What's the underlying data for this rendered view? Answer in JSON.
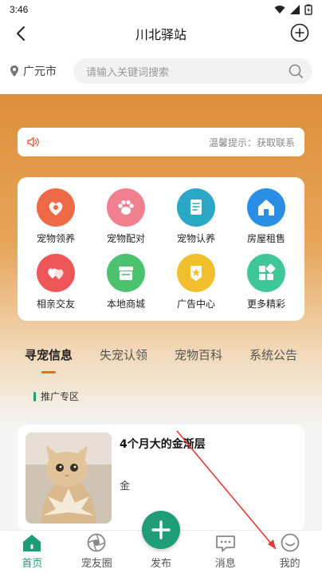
{
  "status_bar": {
    "time": "3:46"
  },
  "header": {
    "title": "川北驿站"
  },
  "search": {
    "location": "广元市",
    "placeholder": "请输入关键词搜索"
  },
  "notice": {
    "text": "温馨提示：获取联系"
  },
  "services": [
    {
      "label": "宠物领养",
      "icon": "pet-adopt-icon",
      "color": "#ee6a47"
    },
    {
      "label": "宠物配对",
      "icon": "paw-icon",
      "color": "#f0808f"
    },
    {
      "label": "宠物认养",
      "icon": "document-icon",
      "color": "#2aa8c5"
    },
    {
      "label": "房屋租售",
      "icon": "house-icon",
      "color": "#2a8fe4"
    },
    {
      "label": "相亲交友",
      "icon": "hearts-icon",
      "color": "#ec5658"
    },
    {
      "label": "本地商城",
      "icon": "shop-icon",
      "color": "#4cc26e"
    },
    {
      "label": "广告中心",
      "icon": "star-badge-icon",
      "color": "#f1bf2d"
    },
    {
      "label": "更多精彩",
      "icon": "grid-icon",
      "color": "#3fc79a"
    }
  ],
  "tabs": [
    {
      "label": "寻宠信息",
      "active": true
    },
    {
      "label": "失宠认领",
      "active": false
    },
    {
      "label": "宠物百科",
      "active": false
    },
    {
      "label": "系统公告",
      "active": false
    }
  ],
  "promo": {
    "label": "推广专区"
  },
  "listing": {
    "title": "4个月大的金渐层",
    "subtitle": "金"
  },
  "bottom_nav": [
    {
      "label": "首页",
      "icon": "home-icon",
      "active": true
    },
    {
      "label": "宠友圈",
      "icon": "camera-shutter-icon",
      "active": false
    },
    {
      "label": "发布",
      "icon": "plus-icon",
      "active": false
    },
    {
      "label": "消息",
      "icon": "message-icon",
      "active": false
    },
    {
      "label": "我的",
      "icon": "smile-icon",
      "active": false
    }
  ],
  "colors": {
    "accent": "#1f9d76",
    "tab_indicator": "#ea6b1c",
    "hero": "#dd8f3b"
  }
}
